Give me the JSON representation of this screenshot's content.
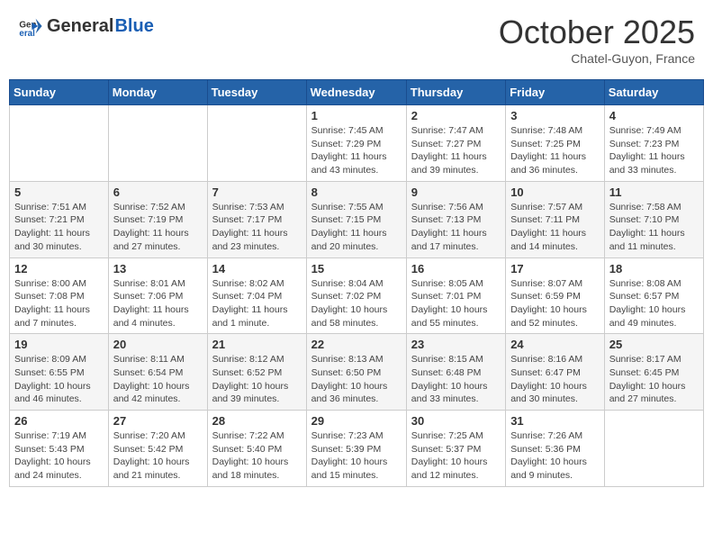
{
  "header": {
    "logo_general": "General",
    "logo_blue": "Blue",
    "month": "October 2025",
    "location": "Chatel-Guyon, France"
  },
  "days_of_week": [
    "Sunday",
    "Monday",
    "Tuesday",
    "Wednesday",
    "Thursday",
    "Friday",
    "Saturday"
  ],
  "weeks": [
    [
      {
        "day": "",
        "info": ""
      },
      {
        "day": "",
        "info": ""
      },
      {
        "day": "",
        "info": ""
      },
      {
        "day": "1",
        "info": "Sunrise: 7:45 AM\nSunset: 7:29 PM\nDaylight: 11 hours and 43 minutes."
      },
      {
        "day": "2",
        "info": "Sunrise: 7:47 AM\nSunset: 7:27 PM\nDaylight: 11 hours and 39 minutes."
      },
      {
        "day": "3",
        "info": "Sunrise: 7:48 AM\nSunset: 7:25 PM\nDaylight: 11 hours and 36 minutes."
      },
      {
        "day": "4",
        "info": "Sunrise: 7:49 AM\nSunset: 7:23 PM\nDaylight: 11 hours and 33 minutes."
      }
    ],
    [
      {
        "day": "5",
        "info": "Sunrise: 7:51 AM\nSunset: 7:21 PM\nDaylight: 11 hours and 30 minutes."
      },
      {
        "day": "6",
        "info": "Sunrise: 7:52 AM\nSunset: 7:19 PM\nDaylight: 11 hours and 27 minutes."
      },
      {
        "day": "7",
        "info": "Sunrise: 7:53 AM\nSunset: 7:17 PM\nDaylight: 11 hours and 23 minutes."
      },
      {
        "day": "8",
        "info": "Sunrise: 7:55 AM\nSunset: 7:15 PM\nDaylight: 11 hours and 20 minutes."
      },
      {
        "day": "9",
        "info": "Sunrise: 7:56 AM\nSunset: 7:13 PM\nDaylight: 11 hours and 17 minutes."
      },
      {
        "day": "10",
        "info": "Sunrise: 7:57 AM\nSunset: 7:11 PM\nDaylight: 11 hours and 14 minutes."
      },
      {
        "day": "11",
        "info": "Sunrise: 7:58 AM\nSunset: 7:10 PM\nDaylight: 11 hours and 11 minutes."
      }
    ],
    [
      {
        "day": "12",
        "info": "Sunrise: 8:00 AM\nSunset: 7:08 PM\nDaylight: 11 hours and 7 minutes."
      },
      {
        "day": "13",
        "info": "Sunrise: 8:01 AM\nSunset: 7:06 PM\nDaylight: 11 hours and 4 minutes."
      },
      {
        "day": "14",
        "info": "Sunrise: 8:02 AM\nSunset: 7:04 PM\nDaylight: 11 hours and 1 minute."
      },
      {
        "day": "15",
        "info": "Sunrise: 8:04 AM\nSunset: 7:02 PM\nDaylight: 10 hours and 58 minutes."
      },
      {
        "day": "16",
        "info": "Sunrise: 8:05 AM\nSunset: 7:01 PM\nDaylight: 10 hours and 55 minutes."
      },
      {
        "day": "17",
        "info": "Sunrise: 8:07 AM\nSunset: 6:59 PM\nDaylight: 10 hours and 52 minutes."
      },
      {
        "day": "18",
        "info": "Sunrise: 8:08 AM\nSunset: 6:57 PM\nDaylight: 10 hours and 49 minutes."
      }
    ],
    [
      {
        "day": "19",
        "info": "Sunrise: 8:09 AM\nSunset: 6:55 PM\nDaylight: 10 hours and 46 minutes."
      },
      {
        "day": "20",
        "info": "Sunrise: 8:11 AM\nSunset: 6:54 PM\nDaylight: 10 hours and 42 minutes."
      },
      {
        "day": "21",
        "info": "Sunrise: 8:12 AM\nSunset: 6:52 PM\nDaylight: 10 hours and 39 minutes."
      },
      {
        "day": "22",
        "info": "Sunrise: 8:13 AM\nSunset: 6:50 PM\nDaylight: 10 hours and 36 minutes."
      },
      {
        "day": "23",
        "info": "Sunrise: 8:15 AM\nSunset: 6:48 PM\nDaylight: 10 hours and 33 minutes."
      },
      {
        "day": "24",
        "info": "Sunrise: 8:16 AM\nSunset: 6:47 PM\nDaylight: 10 hours and 30 minutes."
      },
      {
        "day": "25",
        "info": "Sunrise: 8:17 AM\nSunset: 6:45 PM\nDaylight: 10 hours and 27 minutes."
      }
    ],
    [
      {
        "day": "26",
        "info": "Sunrise: 7:19 AM\nSunset: 5:43 PM\nDaylight: 10 hours and 24 minutes."
      },
      {
        "day": "27",
        "info": "Sunrise: 7:20 AM\nSunset: 5:42 PM\nDaylight: 10 hours and 21 minutes."
      },
      {
        "day": "28",
        "info": "Sunrise: 7:22 AM\nSunset: 5:40 PM\nDaylight: 10 hours and 18 minutes."
      },
      {
        "day": "29",
        "info": "Sunrise: 7:23 AM\nSunset: 5:39 PM\nDaylight: 10 hours and 15 minutes."
      },
      {
        "day": "30",
        "info": "Sunrise: 7:25 AM\nSunset: 5:37 PM\nDaylight: 10 hours and 12 minutes."
      },
      {
        "day": "31",
        "info": "Sunrise: 7:26 AM\nSunset: 5:36 PM\nDaylight: 10 hours and 9 minutes."
      },
      {
        "day": "",
        "info": ""
      }
    ]
  ]
}
